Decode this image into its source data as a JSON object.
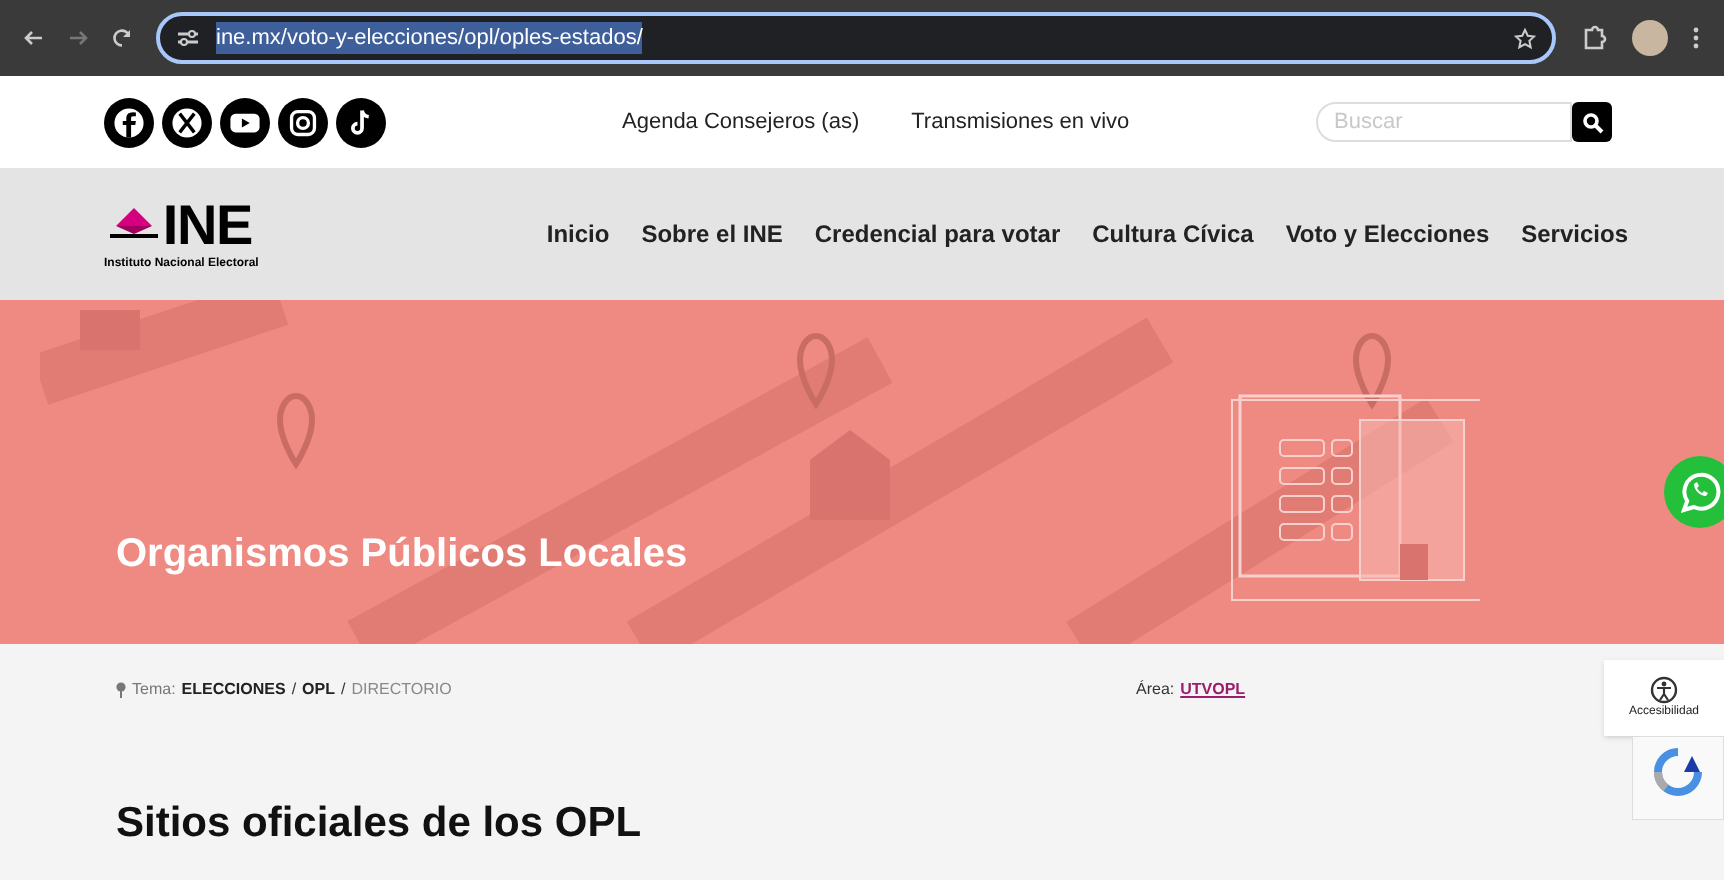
{
  "browser": {
    "url": "ine.mx/voto-y-elecciones/opl/oples-estados/"
  },
  "top_bar": {
    "links": [
      "Agenda Consejeros (as)",
      "Transmisiones en vivo"
    ],
    "search": {
      "placeholder": "Buscar"
    }
  },
  "logo": {
    "text": "INE",
    "subtitle": "Instituto Nacional Electoral"
  },
  "nav": {
    "items": [
      "Inicio",
      "Sobre el INE",
      "Credencial para votar",
      "Cultura Cívica",
      "Voto y Elecciones",
      "Servicios"
    ]
  },
  "hero": {
    "title": "Organismos Públicos Locales"
  },
  "breadcrumb": {
    "label": "Tema:",
    "items": [
      {
        "text": "ELECCIONES",
        "kind": "link"
      },
      {
        "text": "/",
        "kind": "separator"
      },
      {
        "text": "OPL",
        "kind": "link"
      },
      {
        "text": "/",
        "kind": "separator"
      },
      {
        "text": "DIRECTORIO",
        "kind": "current"
      }
    ]
  },
  "area": {
    "label": "Área:",
    "link": "UTVOPL"
  },
  "accessibility": {
    "label": "Accesibilidad"
  },
  "heading": "Sitios oficiales de los OPL"
}
